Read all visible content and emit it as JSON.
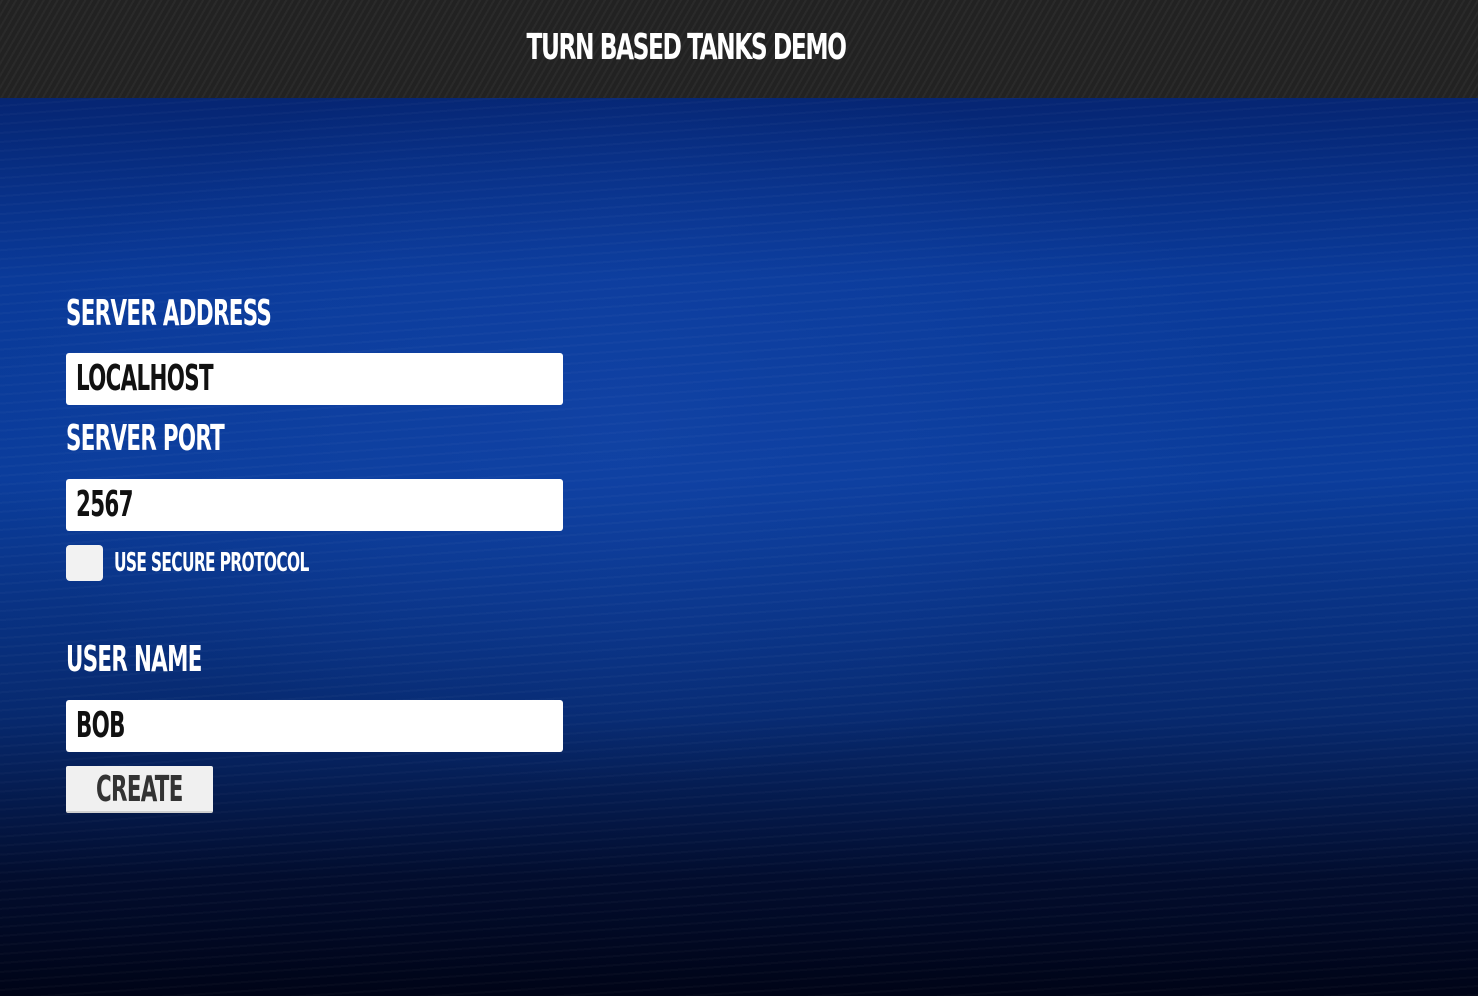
{
  "app": {
    "title": "TURN BASED TANKS DEMO"
  },
  "form": {
    "server_address": {
      "label": "SERVER ADDRESS",
      "value": "LOCALHOST"
    },
    "server_port": {
      "label": "SERVER PORT",
      "value": "2567"
    },
    "secure_protocol": {
      "label": "USE SECURE PROTOCOL",
      "checked": false
    },
    "user_name": {
      "label": "USER NAME",
      "value": "BOB"
    },
    "create_button": {
      "label": "CREATE"
    }
  },
  "colors": {
    "header_bg": "#222222",
    "background_top": "#031a5e",
    "background_mid": "#0b3d9c",
    "background_bottom": "#000417",
    "field_bg": "#ffffff",
    "button_bg": "#f0f0f0",
    "text_light": "#ffffff",
    "text_dark": "#111111"
  }
}
